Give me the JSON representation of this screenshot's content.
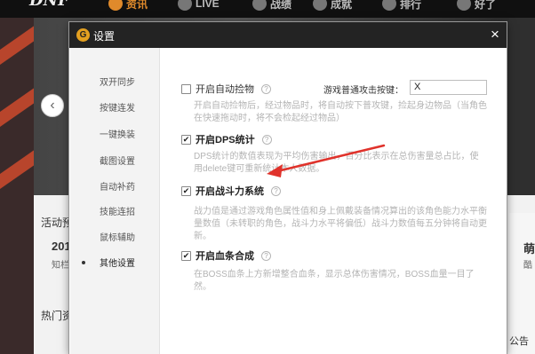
{
  "topnav": {
    "logo": "DNF",
    "items": [
      {
        "label": "资讯",
        "active": true
      },
      {
        "label": "LIVE",
        "active": false
      },
      {
        "label": "战绩",
        "active": false
      },
      {
        "label": "成就",
        "active": false
      },
      {
        "label": "排行",
        "active": false
      },
      {
        "label": "好了",
        "active": false
      }
    ]
  },
  "background": {
    "activity_label": "活动预",
    "year_fragment": "201",
    "sub_fragment": "知栏",
    "hot_label": "热门资",
    "right_fragment_1": "萌",
    "right_fragment_2": "酷",
    "right_fragment_3": "公告"
  },
  "dialog": {
    "title": "设置",
    "close": "×",
    "sidebar": [
      {
        "label": "双开同步"
      },
      {
        "label": "按键连发"
      },
      {
        "label": "一键换装"
      },
      {
        "label": "截图设置"
      },
      {
        "label": "自动补药"
      },
      {
        "label": "技能连招"
      },
      {
        "label": "鼠标辅助"
      },
      {
        "label": "其他设置",
        "active": true
      }
    ],
    "options": {
      "autopick": {
        "checked": false,
        "label": "开启自动捡物",
        "desc": "开启自动捡物后，经过物品时，将自动按下普攻键，捡起身边物品（当角色在快速拖动时，将不会检起经过物品）",
        "key_label": "游戏普通攻击按键：",
        "key_value": "X"
      },
      "dps": {
        "checked": true,
        "label": "开启DPS统计",
        "desc": "DPS统计的数值表现为平均伤害输出，百分比表示在总伤害量总占比，使用delete键可重新统计本人数据。"
      },
      "power": {
        "checked": true,
        "label": "开启战斗力系统",
        "desc": "战力值是通过游戏角色属性值和身上佩戴装备情况算出的该角色能力水平衡量数值（未转职的角色，战斗力水平将偏低）战斗力数值每五分钟将自动更新。"
      },
      "bloodbar": {
        "checked": true,
        "label": "开启血条合成",
        "desc": "在BOSS血条上方新增整合血条，显示总体伤害情况，BOSS血量一目了然。"
      }
    }
  },
  "colors": {
    "accent": "#e08a2b",
    "titlebar": "#232323",
    "arrow": "#e0322b"
  },
  "icons": {
    "check": "✔",
    "help": "?",
    "left_arrow": "‹"
  }
}
